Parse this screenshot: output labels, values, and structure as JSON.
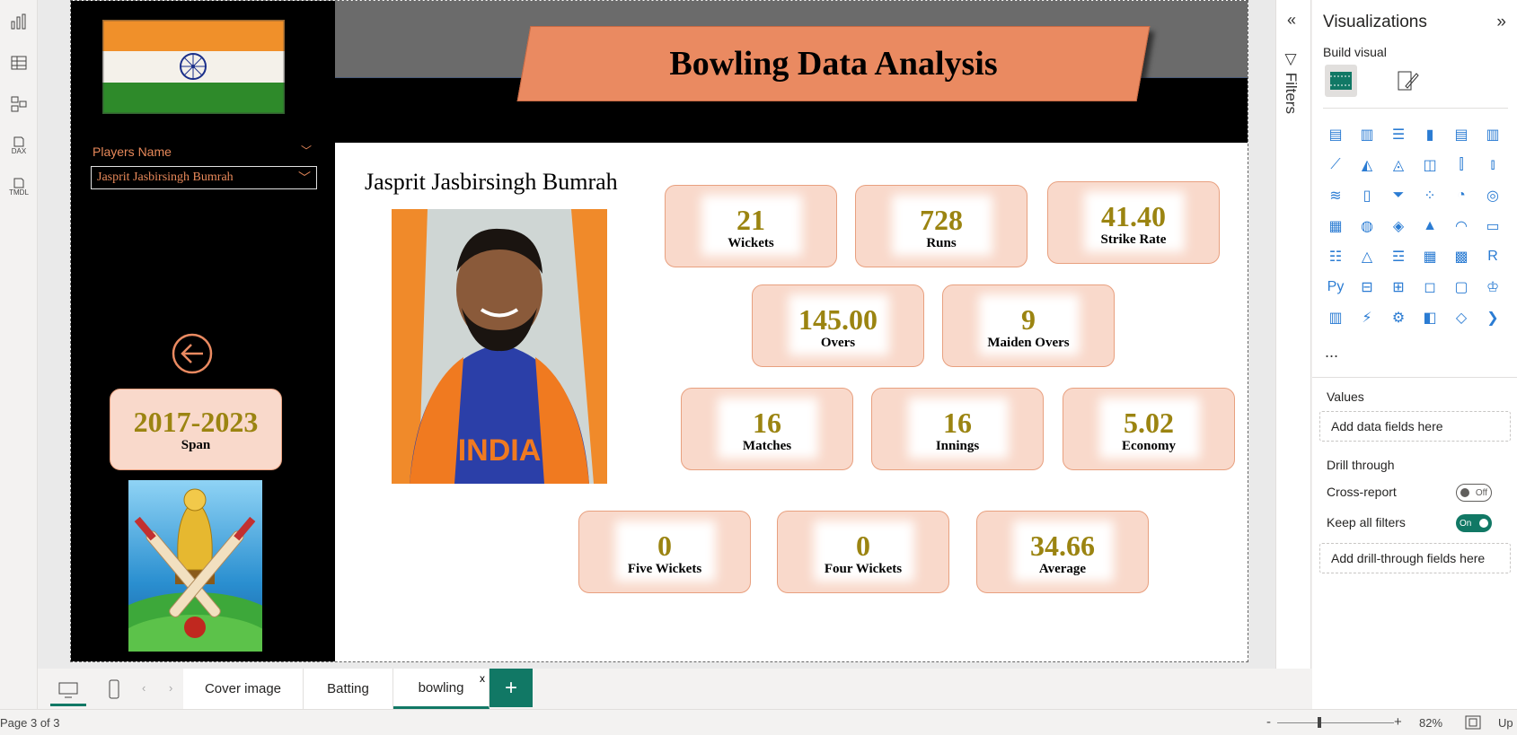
{
  "report": {
    "title": "Bowling Data Analysis",
    "slicer_title": "Players Name",
    "selected_player": "Jasprit Jasbirsingh Bumrah",
    "player_heading": "Jasprit Jasbirsingh Bumrah",
    "photo_text": "INDIA",
    "span": {
      "value": "2017-2023",
      "label": "Span"
    },
    "cards": [
      {
        "value": "21",
        "label": "Wickets"
      },
      {
        "value": "728",
        "label": "Runs"
      },
      {
        "value": "41.40",
        "label": "Strike Rate"
      },
      {
        "value": "145.00",
        "label": "Overs"
      },
      {
        "value": "9",
        "label": "Maiden Overs"
      },
      {
        "value": "16",
        "label": "Matches"
      },
      {
        "value": "16",
        "label": "Innings"
      },
      {
        "value": "5.02",
        "label": "Economy"
      },
      {
        "value": "0",
        "label": "Five Wickets"
      },
      {
        "value": "0",
        "label": "Four Wickets"
      },
      {
        "value": "34.66",
        "label": "Average"
      }
    ],
    "value_color": "#9b8411",
    "accent": "#ea8a61"
  },
  "filters": {
    "label": "Filters"
  },
  "viz": {
    "title": "Visualizations",
    "build_label": "Build visual",
    "values_label": "Values",
    "values_placeholder": "Add data fields here",
    "drill_label": "Drill through",
    "cross_report_label": "Cross-report",
    "cross_report_state": "Off",
    "keep_filters_label": "Keep all filters",
    "keep_filters_state": "On",
    "drill_placeholder": "Add drill-through fields here",
    "more": "..."
  },
  "tabs": [
    {
      "label": "Cover image"
    },
    {
      "label": "Batting"
    },
    {
      "label": "bowling",
      "close": "x"
    }
  ],
  "add_tab": "+",
  "status": {
    "page": "Page 3 of 3",
    "zoom": "82%",
    "minus": "-",
    "plus": "+",
    "update": "Up"
  },
  "rail_labels": {
    "dax": "DAX",
    "tmdl": "TMDL"
  }
}
